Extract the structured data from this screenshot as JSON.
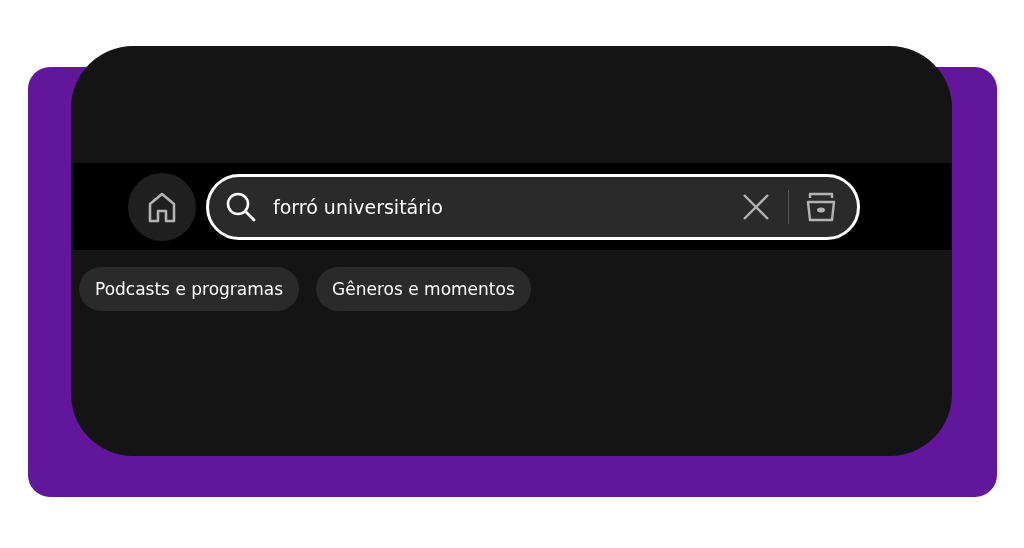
{
  "search": {
    "value": "forró universitário",
    "focused": true
  },
  "chips": [
    {
      "label": "Podcasts e programas"
    },
    {
      "label": "Gêneros e momentos"
    }
  ]
}
